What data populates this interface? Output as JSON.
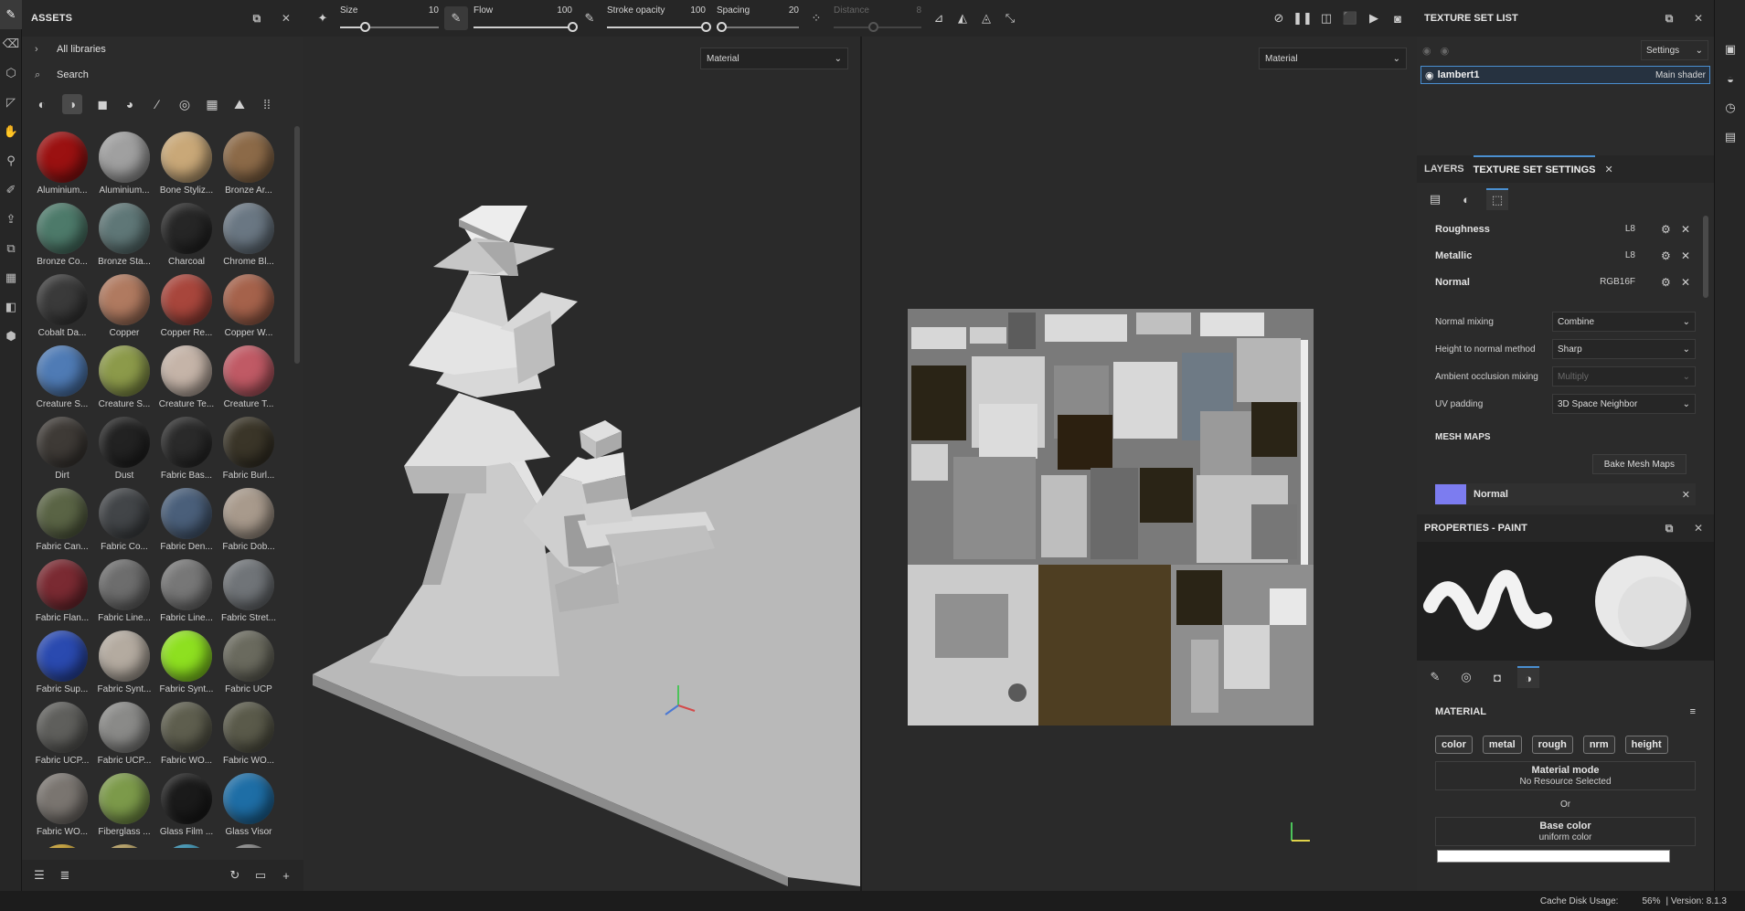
{
  "tools": [
    "paint-brush",
    "eraser",
    "projection",
    "polygon-fill",
    "smudge",
    "clone",
    "color-picker",
    "bake",
    "material-picker",
    "geometry-mask",
    "render",
    "settings-disabled",
    "export",
    "shelf"
  ],
  "assets": {
    "title": "ASSETS",
    "all_libraries": "All libraries",
    "search_placeholder": "Search",
    "materials": [
      {
        "label": "Aluminium...",
        "color": "#9b1111"
      },
      {
        "label": "Aluminium...",
        "color": "#a0a0a0"
      },
      {
        "label": "Bone Styliz...",
        "color": "#c9a878"
      },
      {
        "label": "Bronze Ar...",
        "color": "#8c6a48"
      },
      {
        "label": "Bronze Co...",
        "color": "#4d7a6a"
      },
      {
        "label": "Bronze Sta...",
        "color": "#5f7777"
      },
      {
        "label": "Charcoal",
        "color": "#262626"
      },
      {
        "label": "Chrome Bl...",
        "color": "#6a7783"
      },
      {
        "label": "Cobalt Da...",
        "color": "#3a3a3a"
      },
      {
        "label": "Copper",
        "color": "#b07a60"
      },
      {
        "label": "Copper Re...",
        "color": "#a8463c"
      },
      {
        "label": "Copper W...",
        "color": "#a5624b"
      },
      {
        "label": "Creature S...",
        "color": "#4f7bb5"
      },
      {
        "label": "Creature S...",
        "color": "#8c9a4a"
      },
      {
        "label": "Creature Te...",
        "color": "#c5b4a8"
      },
      {
        "label": "Creature T...",
        "color": "#c05a65"
      },
      {
        "label": "Dirt",
        "color": "#3e3a36"
      },
      {
        "label": "Dust",
        "color": "#222222"
      },
      {
        "label": "Fabric Bas...",
        "color": "#2a2a2a"
      },
      {
        "label": "Fabric Burl...",
        "color": "#3a3528"
      },
      {
        "label": "Fabric Can...",
        "color": "#5a6445"
      },
      {
        "label": "Fabric Co...",
        "color": "#424548"
      },
      {
        "label": "Fabric Den...",
        "color": "#4a5f7a"
      },
      {
        "label": "Fabric Dob...",
        "color": "#a89a8c"
      },
      {
        "label": "Fabric Flan...",
        "color": "#7a2a32"
      },
      {
        "label": "Fabric Line...",
        "color": "#6d6d6d"
      },
      {
        "label": "Fabric Line...",
        "color": "#777777"
      },
      {
        "label": "Fabric Stret...",
        "color": "#707478"
      },
      {
        "label": "Fabric Sup...",
        "color": "#2a4ab0"
      },
      {
        "label": "Fabric Synt...",
        "color": "#b4aba0"
      },
      {
        "label": "Fabric Synt...",
        "color": "#8ee020"
      },
      {
        "label": "Fabric UCP",
        "color": "#6a6a5e"
      },
      {
        "label": "Fabric UCP...",
        "color": "#5f5f5c"
      },
      {
        "label": "Fabric UCP...",
        "color": "#8a8a88"
      },
      {
        "label": "Fabric WO...",
        "color": "#5e5e4e"
      },
      {
        "label": "Fabric WO...",
        "color": "#5a5a4a"
      },
      {
        "label": "Fabric WO...",
        "color": "#7a7570"
      },
      {
        "label": "Fiberglass ...",
        "color": "#7c9a4a"
      },
      {
        "label": "Glass Film ...",
        "color": "#1a1a1a"
      },
      {
        "label": "Glass Visor",
        "color": "#1e6ea6"
      },
      {
        "label": "",
        "color": "#c49a22"
      },
      {
        "label": "",
        "color": "#b39a55"
      },
      {
        "label": "",
        "color": "#2b8cb0"
      },
      {
        "label": "",
        "color": "#808080"
      }
    ]
  },
  "toolbar": {
    "size_label": "Size",
    "size_value": "10",
    "size_fraction": 0.25,
    "flow_label": "Flow",
    "flow_value": "100",
    "flow_fraction": 1.0,
    "opacity_label": "Stroke opacity",
    "opacity_value": "100",
    "opacity_fraction": 1.0,
    "spacing_label": "Spacing",
    "spacing_value": "20",
    "spacing_fraction": 0.05,
    "distance_label": "Distance",
    "distance_value": "8",
    "distance_fraction": 0.45
  },
  "viewport_3d": {
    "mode_select": "Material"
  },
  "viewport_uv": {
    "mode_select": "Material"
  },
  "texture_set_list": {
    "title": "TEXTURE SET LIST",
    "settings_label": "Settings",
    "set_name": "lambert1",
    "shader_name": "Main shader"
  },
  "tabs": {
    "layers": "LAYERS",
    "texture_set_settings": "TEXTURE SET SETTINGS"
  },
  "channels": [
    {
      "name": "Roughness",
      "format": "L8"
    },
    {
      "name": "Metallic",
      "format": "L8"
    },
    {
      "name": "Normal",
      "format": "RGB16F"
    }
  ],
  "options": [
    {
      "label": "Normal mixing",
      "value": "Combine",
      "disabled": false
    },
    {
      "label": "Height to normal method",
      "value": "Sharp",
      "disabled": false
    },
    {
      "label": "Ambient occlusion mixing",
      "value": "Multiply",
      "disabled": true
    },
    {
      "label": "UV padding",
      "value": "3D Space Neighbor",
      "disabled": false
    }
  ],
  "mesh_maps": {
    "title": "MESH MAPS",
    "bake_button": "Bake Mesh Maps",
    "first_map": "Normal"
  },
  "properties": {
    "title": "PROPERTIES - PAINT",
    "material_title": "MATERIAL",
    "chips": [
      "color",
      "metal",
      "rough",
      "nrm",
      "height"
    ],
    "material_mode_title": "Material mode",
    "material_mode_value": "No Resource Selected",
    "or_label": "Or",
    "base_color_title": "Base color",
    "base_color_value": "uniform color"
  },
  "status": {
    "cache_label": "Cache Disk Usage:",
    "cache_value": "56%",
    "version": "| Version: 8.1.3"
  },
  "colors": {
    "accent": "#4a8fd0",
    "panel": "#2b2b2b",
    "viewport": "#2a2a2a"
  }
}
